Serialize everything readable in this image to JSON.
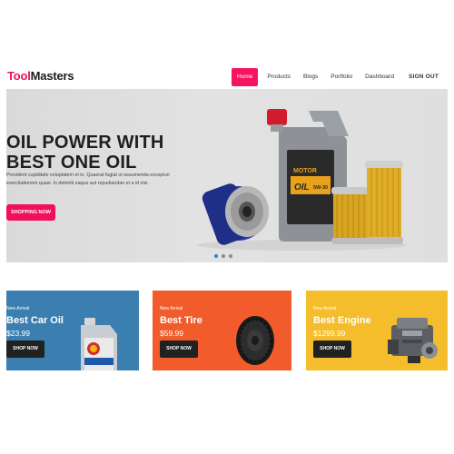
{
  "brand": {
    "accent": "Tool",
    "rest": "Masters"
  },
  "nav": {
    "items": [
      "Home",
      "Products",
      "Blogs",
      "Portfolio",
      "Dashboard"
    ],
    "signout": "SIGN OUT"
  },
  "hero": {
    "title_line1": "OIL POWER WITH",
    "title_line2": "BEST ONE OIL",
    "text": "Provident cupiditate voluptatem et in. Quaerat fugiat ut assumenda excepturi exercitationem quasi. In deleniti eaque aut repudiandae et a id nisi.",
    "button": "SHOPPING NOW",
    "jug_label_brand": "MOTOR",
    "jug_label_oil": "OIL",
    "jug_label_grade": "5W-30"
  },
  "cards": [
    {
      "label": "New Arrival",
      "title": "Best Car Oil",
      "price": "$23.99",
      "button": "SHOP NOW"
    },
    {
      "label": "New Arrival",
      "title": "Best Tire",
      "price": "$59.99",
      "button": "SHOP NOW"
    },
    {
      "label": "New Arrival",
      "title": "Best Engine",
      "price": "$1299.99",
      "button": "SHOP NOW"
    }
  ],
  "colors": {
    "accent": "#f5145f",
    "card_blue": "#3b7fb0",
    "card_orange": "#f25c2c",
    "card_yellow": "#f5bd2c"
  }
}
